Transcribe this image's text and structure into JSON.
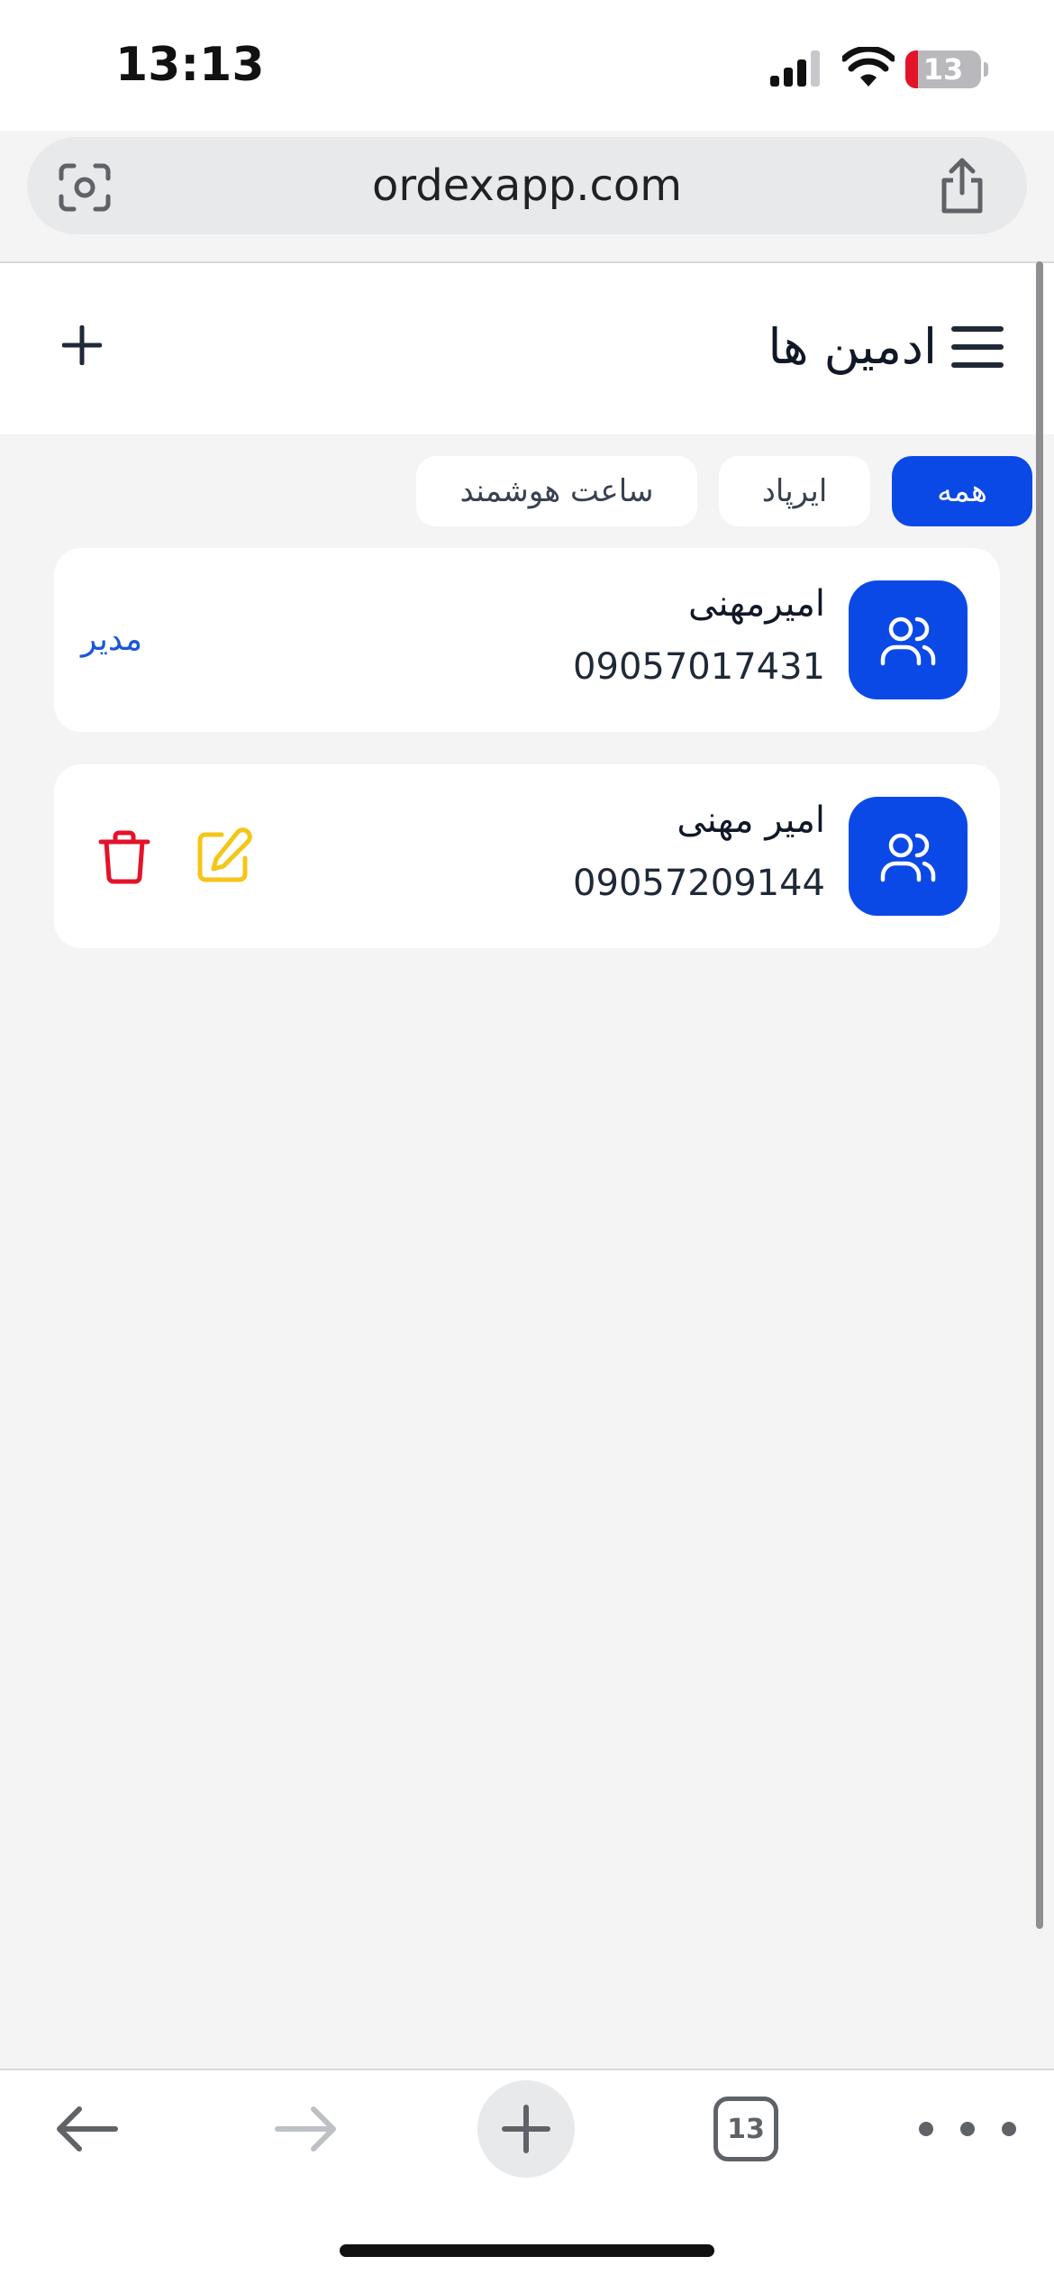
{
  "status_bar": {
    "time": "13:13",
    "battery_level": "13",
    "icons": [
      "cellular-signal-icon",
      "wifi-icon",
      "battery-icon"
    ]
  },
  "browser": {
    "url": "ordexapp.com",
    "icons": [
      "lens-icon",
      "share-icon"
    ]
  },
  "header": {
    "title": "ادمین ها",
    "icons": [
      "menu-icon",
      "plus-icon"
    ]
  },
  "tabs": [
    {
      "label": "همه",
      "active": true
    },
    {
      "label": "ایرپاد",
      "active": false
    },
    {
      "label": "ساعت هوشمند",
      "active": false
    }
  ],
  "admins": [
    {
      "name": "امیرمهنی",
      "phone": "09057017431",
      "role": "مدیر",
      "icon": "users-icon"
    },
    {
      "name": "امیر مهنی",
      "phone": "09057209144",
      "actions": [
        "edit-icon",
        "trash-icon"
      ],
      "icon": "users-icon"
    }
  ],
  "bottom_toolbar": {
    "tab_count": "13",
    "icons": [
      "back-arrow-icon",
      "forward-arrow-icon",
      "plus-icon",
      "tabs-icon",
      "more-icon"
    ]
  },
  "colors": {
    "primary": "#0b49e6",
    "delete": "#e3132a",
    "edit": "#f5c518",
    "role_text": "#1a56db",
    "background": "#f4f4f5"
  }
}
